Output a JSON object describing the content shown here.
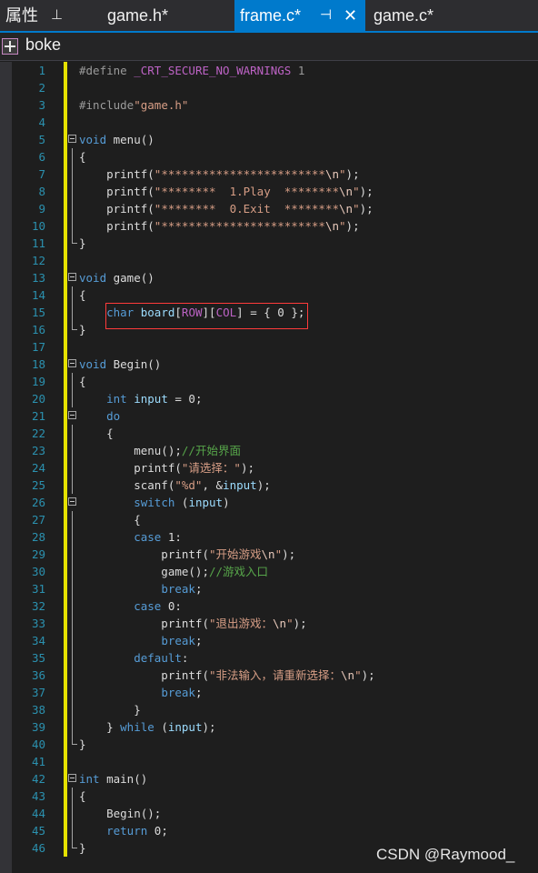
{
  "tabs": [
    {
      "label": "属性",
      "pin": "⊥",
      "active": false
    },
    {
      "label": "game.h*",
      "active": false
    },
    {
      "label": "frame.c*",
      "pin": "⊣",
      "close": "✕",
      "active": true
    },
    {
      "label": "game.c*",
      "active": false
    }
  ],
  "project": {
    "name": "boke",
    "icon": "project-icon"
  },
  "editor": {
    "lines": [
      {
        "n": "1",
        "html": "<span class=\"pp\">#define </span><span class=\"ppname\">_CRT_SECURE_NO_WARNINGS</span><span class=\"pp\"> 1</span>"
      },
      {
        "n": "2",
        "html": ""
      },
      {
        "n": "3",
        "html": "<span class=\"pp\">#include</span><span class=\"str\">\"game.h\"</span>"
      },
      {
        "n": "4",
        "html": ""
      },
      {
        "n": "5",
        "html": "<span class=\"kw\">void</span> menu()"
      },
      {
        "n": "6",
        "html": "{"
      },
      {
        "n": "7",
        "html": "    printf(<span class=\"str\">\"************************</span><span class=\"esc\">\\n</span><span class=\"str\">\"</span>);"
      },
      {
        "n": "8",
        "html": "    printf(<span class=\"str\">\"********  1.Play  ********</span><span class=\"esc\">\\n</span><span class=\"str\">\"</span>);"
      },
      {
        "n": "9",
        "html": "    printf(<span class=\"str\">\"********  0.Exit  ********</span><span class=\"esc\">\\n</span><span class=\"str\">\"</span>);"
      },
      {
        "n": "10",
        "html": "    printf(<span class=\"str\">\"************************</span><span class=\"esc\">\\n</span><span class=\"str\">\"</span>);"
      },
      {
        "n": "11",
        "html": "}"
      },
      {
        "n": "12",
        "html": ""
      },
      {
        "n": "13",
        "html": "<span class=\"kw\">void</span> game()"
      },
      {
        "n": "14",
        "html": "{"
      },
      {
        "n": "15",
        "html": "    <span class=\"kw\">char</span> <span class=\"var\">board</span>[<span class=\"mac\">ROW</span>][<span class=\"mac\">COL</span>] = { 0 };"
      },
      {
        "n": "16",
        "html": "}"
      },
      {
        "n": "17",
        "html": ""
      },
      {
        "n": "18",
        "html": "<span class=\"kw\">void</span> Begin()"
      },
      {
        "n": "19",
        "html": "{"
      },
      {
        "n": "20",
        "html": "    <span class=\"kw\">int</span> <span class=\"var\">input</span> = 0;"
      },
      {
        "n": "21",
        "html": "    <span class=\"kw\">do</span>"
      },
      {
        "n": "22",
        "html": "    {"
      },
      {
        "n": "23",
        "html": "        menu();<span class=\"cmt\">//开始界面</span>"
      },
      {
        "n": "24",
        "html": "        printf(<span class=\"str\">\"请选择：\"</span>);"
      },
      {
        "n": "25",
        "html": "        scanf(<span class=\"str\">\"%d\"</span>, &amp;<span class=\"var\">input</span>);"
      },
      {
        "n": "26",
        "html": "        <span class=\"kw\">switch</span> (<span class=\"var\">input</span>)"
      },
      {
        "n": "27",
        "html": "        {"
      },
      {
        "n": "28",
        "html": "        <span class=\"kw\">case</span> 1:"
      },
      {
        "n": "29",
        "html": "            printf(<span class=\"str\">\"开始游戏</span><span class=\"esc\">\\n</span><span class=\"str\">\"</span>);"
      },
      {
        "n": "30",
        "html": "            game();<span class=\"cmt\">//游戏入口</span>"
      },
      {
        "n": "31",
        "html": "            <span class=\"kw\">break</span>;"
      },
      {
        "n": "32",
        "html": "        <span class=\"kw\">case</span> 0:"
      },
      {
        "n": "33",
        "html": "            printf(<span class=\"str\">\"退出游戏：</span><span class=\"esc\">\\n</span><span class=\"str\">\"</span>);"
      },
      {
        "n": "34",
        "html": "            <span class=\"kw\">break</span>;"
      },
      {
        "n": "35",
        "html": "        <span class=\"kw\">default</span>:"
      },
      {
        "n": "36",
        "html": "            printf(<span class=\"str\">\"非法输入，请重新选择：</span><span class=\"esc\">\\n</span><span class=\"str\">\"</span>);"
      },
      {
        "n": "37",
        "html": "            <span class=\"kw\">break</span>;"
      },
      {
        "n": "38",
        "html": "        }"
      },
      {
        "n": "39",
        "html": "    } <span class=\"kw\">while</span> (<span class=\"var\">input</span>);"
      },
      {
        "n": "40",
        "html": "}"
      },
      {
        "n": "41",
        "html": ""
      },
      {
        "n": "42",
        "html": "<span class=\"kw\">int</span> main()"
      },
      {
        "n": "43",
        "html": "{"
      },
      {
        "n": "44",
        "html": "    Begin();"
      },
      {
        "n": "45",
        "html": "    <span class=\"kw\">return</span> 0;"
      },
      {
        "n": "46",
        "html": "}"
      }
    ],
    "folds": [
      5,
      13,
      18,
      21,
      26,
      42
    ],
    "fold_ranges": [
      [
        5,
        11
      ],
      [
        13,
        16
      ],
      [
        18,
        40
      ],
      [
        21,
        39
      ],
      [
        26,
        38
      ],
      [
        42,
        46
      ]
    ],
    "changed_lines": true
  },
  "watermark": "CSDN @Raymood_",
  "colors": {
    "background": "#1e1e1e",
    "active_tab": "#007acc",
    "keyword": "#569cd6",
    "string": "#d69d85",
    "comment": "#57a64a",
    "line_number": "#2b91af",
    "change_bar": "#e5e100",
    "highlight_box": "#ff3b3b"
  }
}
